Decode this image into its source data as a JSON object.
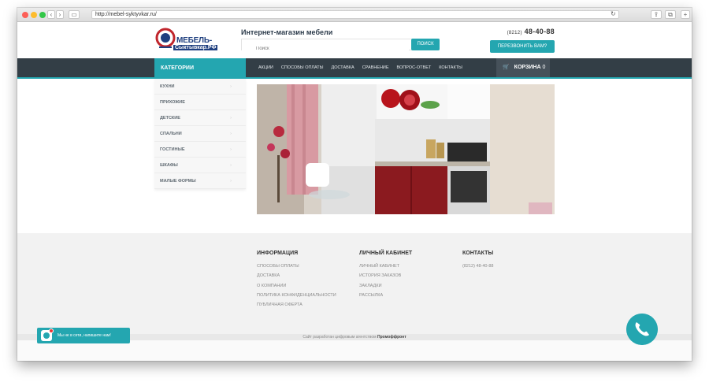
{
  "browser": {
    "url": "http://mebel-syktyvkar.ru/",
    "back_icon": "chevron-left-icon",
    "forward_icon": "chevron-right-icon"
  },
  "header": {
    "logo_line1": "МЕБЕЛЬ-",
    "logo_line2": "Сыктывкар.РФ",
    "site_title": "Интернет-магазин мебели",
    "search_placeholder": "Поиск",
    "search_button": "ПОИСК",
    "phone_code": "(8212)",
    "phone_number": "48-40-88",
    "callback_button": "ПЕРЕЗВОНИТЬ ВАМ?"
  },
  "navbar": {
    "categories_label": "КАТЕГОРИИ",
    "menu": [
      "АКЦИИ",
      "СПОСОБЫ ОПЛАТЫ",
      "ДОСТАВКА",
      "СРАВНЕНИЕ",
      "ВОПРОС-ОТВЕТ",
      "КОНТАКТЫ"
    ],
    "cart_label": "КОРЗИНА",
    "cart_count": "0"
  },
  "sidebar": {
    "items": [
      "КУХНИ",
      "ПРИХОЖИЕ",
      "ДЕТСКИЕ",
      "СПАЛЬНИ",
      "ГОСТИНЫЕ",
      "ШКАФЫ",
      "МАЛЫЕ ФОРМЫ"
    ]
  },
  "footer": {
    "info": {
      "title": "ИНФОРМАЦИЯ",
      "links": [
        "СПОСОБЫ ОПЛАТЫ",
        "ДОСТАВКА",
        "О КОМПАНИИ",
        "ПОЛИТИКА КОНФИДЕНЦИАЛЬНОСТИ",
        "ПУБЛИЧНАЯ ОФЕРТА"
      ]
    },
    "account": {
      "title": "ЛИЧНЫЙ КАБИНЕТ",
      "links": [
        "ЛИЧНЫЙ КАБИНЕТ",
        "ИСТОРИЯ ЗАКАЗОВ",
        "ЗАКЛАДКИ",
        "РАССЫЛКА"
      ]
    },
    "contacts": {
      "title": "КОНТАКТЫ",
      "phone": "(8212) 48-40-88"
    },
    "credit_prefix": "Сайт разработан цифровым агентством",
    "credit_agency": "Промоффронт"
  },
  "chat_widget": {
    "label": "Мы не в сети, напишите нам!"
  },
  "colors": {
    "accent": "#24a6b0",
    "navbar_bg": "#333e46"
  }
}
